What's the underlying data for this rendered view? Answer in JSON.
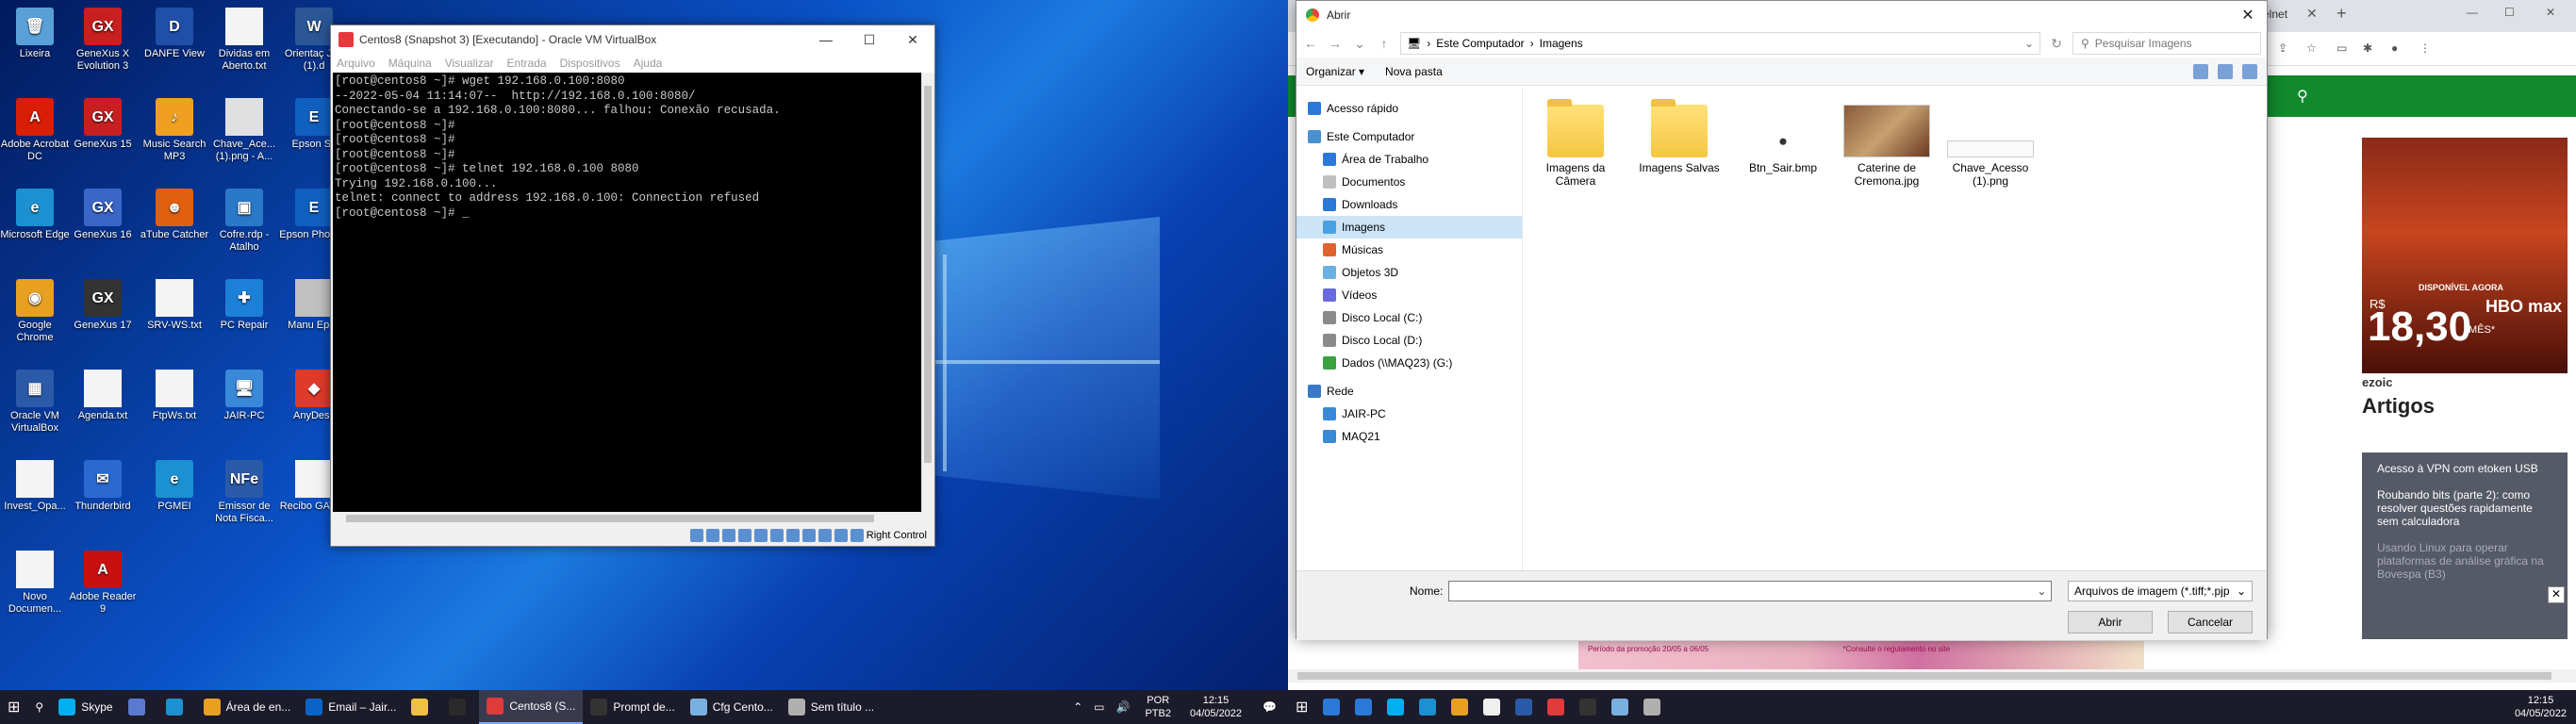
{
  "desktop": {
    "icons": [
      {
        "label": "Lixeira",
        "color": "#5aa0d8",
        "glyph": "🗑"
      },
      {
        "label": "GeneXus X Evolution 3",
        "color": "#c82020",
        "glyph": "GX"
      },
      {
        "label": "DANFE View",
        "color": "#1f4fa8",
        "glyph": "D"
      },
      {
        "label": "Dividas em Aberto.txt",
        "color": "#f4f4f4",
        "glyph": ""
      },
      {
        "label": "Orientaç Jair (1).d",
        "color": "#2b5797",
        "glyph": "W"
      },
      {
        "label": "Adobe Acrobat DC",
        "color": "#d81e05",
        "glyph": "A"
      },
      {
        "label": "GeneXus 15",
        "color": "#c82020",
        "glyph": "GX"
      },
      {
        "label": "Music Search MP3",
        "color": "#f0a020",
        "glyph": "♪"
      },
      {
        "label": "Chave_Ace... (1).png - A...",
        "color": "#e0e0e0",
        "glyph": ""
      },
      {
        "label": "Epson Sc",
        "color": "#1060c0",
        "glyph": "E"
      },
      {
        "label": "Microsoft Edge",
        "color": "#1c90d0",
        "glyph": "e"
      },
      {
        "label": "GeneXus 16",
        "color": "#3a66c8",
        "glyph": "GX"
      },
      {
        "label": "aTube Catcher",
        "color": "#e06010",
        "glyph": "☻"
      },
      {
        "label": "Cofre.rdp - Atalho",
        "color": "#2a78c8",
        "glyph": "▣"
      },
      {
        "label": "Epson Photo P",
        "color": "#1060c0",
        "glyph": "E"
      },
      {
        "label": "Google Chrome",
        "color": "#e8a020",
        "glyph": "◉"
      },
      {
        "label": "GeneXus 17",
        "color": "#333333",
        "glyph": "GX"
      },
      {
        "label": "SRV-WS.txt",
        "color": "#f4f4f4",
        "glyph": ""
      },
      {
        "label": "PC Repair",
        "color": "#1c80d8",
        "glyph": "✚"
      },
      {
        "label": "Manu Epso",
        "color": "#c0c0c0",
        "glyph": ""
      },
      {
        "label": "Oracle VM VirtualBox",
        "color": "#2a5aa8",
        "glyph": "▦"
      },
      {
        "label": "Agenda.txt",
        "color": "#f4f4f4",
        "glyph": ""
      },
      {
        "label": "FtpWs.txt",
        "color": "#f4f4f4",
        "glyph": ""
      },
      {
        "label": "JAIR-PC",
        "color": "#3a88d8",
        "glyph": "🖥"
      },
      {
        "label": "AnyDesk",
        "color": "#e03a2a",
        "glyph": "◆"
      },
      {
        "label": "Invest_Opa...",
        "color": "#f4f4f4",
        "glyph": ""
      },
      {
        "label": "Thunderbird",
        "color": "#2a6ad0",
        "glyph": "✉"
      },
      {
        "label": "PGMEI",
        "color": "#1c90d0",
        "glyph": "e"
      },
      {
        "label": "Emissor de Nota Fisca...",
        "color": "#2a5aa8",
        "glyph": "NFe"
      },
      {
        "label": "Recibo GAT.txt",
        "color": "#f4f4f4",
        "glyph": ""
      },
      {
        "label": "Novo Documen...",
        "color": "#f4f4f4",
        "glyph": ""
      },
      {
        "label": "Adobe Reader 9",
        "color": "#c81010",
        "glyph": "A"
      }
    ]
  },
  "vbox": {
    "title": "Centos8 (Snapshot 3) [Executando] - Oracle VM VirtualBox",
    "menu": [
      "Arquivo",
      "Máquina",
      "Visualizar",
      "Entrada",
      "Dispositivos",
      "Ajuda"
    ],
    "terminal": "[root@centos8 ~]# wget 192.168.0.100:8080\n--2022-05-04 11:14:07--  http://192.168.0.100:8080/\nConectando-se a 192.168.0.100:8080... falhou: Conexão recusada.\n[root@centos8 ~]#\n[root@centos8 ~]#\n[root@centos8 ~]#\n[root@centos8 ~]# telnet 192.168.0.100 8080\nTrying 192.168.0.100...\ntelnet: connect to address 192.168.0.100: Connection refused\n[root@centos8 ~]# _",
    "status_label": "Right Control"
  },
  "taskbar1": {
    "items": [
      {
        "label": "Skype",
        "color": "#00aff0"
      },
      {
        "label": "",
        "color": "#5a7ad0"
      },
      {
        "label": "",
        "color": "#1c90d0"
      },
      {
        "label": "Área de en...",
        "color": "#e8a020"
      },
      {
        "label": "Email – Jair...",
        "color": "#0a64c8"
      },
      {
        "label": "",
        "color": "#f0c040"
      },
      {
        "label": "",
        "color": "#2a2a2a"
      },
      {
        "label": "Centos8 (S...",
        "color": "#e03a3a"
      },
      {
        "label": "Prompt de...",
        "color": "#333333"
      },
      {
        "label": "Cfg Cento...",
        "color": "#7ab0e0"
      },
      {
        "label": "Sem título ...",
        "color": "#b0b0b0"
      }
    ],
    "lang": "POR",
    "layout": "PTB2",
    "time": "12:15",
    "date": "04/05/2022"
  },
  "dialog": {
    "title": "Abrir",
    "path": [
      "Este Computador",
      "Imagens"
    ],
    "search_placeholder": "Pesquisar Imagens",
    "commands": [
      "Organizar ▾",
      "Nova pasta"
    ],
    "nav": [
      {
        "label": "Acesso rápido",
        "color": "#2a78d8",
        "indent": 0,
        "sel": false
      },
      {
        "label": "Este Computador",
        "color": "#4a90d0",
        "indent": 0,
        "sel": false
      },
      {
        "label": "Área de Trabalho",
        "color": "#2a78d8",
        "indent": 1,
        "sel": false
      },
      {
        "label": "Documentos",
        "color": "#c0c0c0",
        "indent": 1,
        "sel": false
      },
      {
        "label": "Downloads",
        "color": "#2a78d8",
        "indent": 1,
        "sel": false
      },
      {
        "label": "Imagens",
        "color": "#4aa0e0",
        "indent": 1,
        "sel": true
      },
      {
        "label": "Músicas",
        "color": "#e06030",
        "indent": 1,
        "sel": false
      },
      {
        "label": "Objetos 3D",
        "color": "#6ab0e0",
        "indent": 1,
        "sel": false
      },
      {
        "label": "Vídeos",
        "color": "#6a6ae0",
        "indent": 1,
        "sel": false
      },
      {
        "label": "Disco Local (C:)",
        "color": "#8a8a8a",
        "indent": 1,
        "sel": false
      },
      {
        "label": "Disco Local (D:)",
        "color": "#8a8a8a",
        "indent": 1,
        "sel": false
      },
      {
        "label": "Dados (\\\\MAQ23) (G:)",
        "color": "#3aa040",
        "indent": 1,
        "sel": false
      },
      {
        "label": "Rede",
        "color": "#3a78c8",
        "indent": 0,
        "sel": false
      },
      {
        "label": "JAIR-PC",
        "color": "#3a88d8",
        "indent": 1,
        "sel": false
      },
      {
        "label": "MAQ21",
        "color": "#3a88d8",
        "indent": 1,
        "sel": false
      }
    ],
    "files": [
      {
        "label": "Imagens da Câmera",
        "kind": "folder"
      },
      {
        "label": "Imagens Salvas",
        "kind": "folder"
      },
      {
        "label": "Btn_Sair.bmp",
        "kind": "bmp"
      },
      {
        "label": "Caterine de Cremona.jpg",
        "kind": "photo"
      },
      {
        "label": "Chave_Acesso (1).png",
        "kind": "png"
      }
    ],
    "name_label": "Nome:",
    "name_value": "",
    "filter": "Arquivos de imagem (*.tiff;*.pjp",
    "open": "Abrir",
    "cancel": "Cancelar"
  },
  "browser": {
    "tab_fragment": "elnet",
    "ad": {
      "available": "DISPONÍVEL AGORA",
      "currency": "R$",
      "price": "18,30",
      "per": "/MÊS*",
      "brand": "HBO max"
    },
    "ezoic": "ezoic",
    "artigos": "Artigos",
    "articles": [
      "Acesso à VPN com etoken USB",
      "Roubando bits (parte 2): como resolver questões rapidamente sem calculadora",
      "Usando Linux para operar plataformas de análise gráfica na Bovespa (B3)"
    ],
    "banner_text": "Período da promoção 20/05 a 06/05",
    "banner_note": "*Consulte o regulamento no site"
  },
  "taskbar2": {
    "icons": [
      "#2a78d8",
      "#2a78d8",
      "#00aff0",
      "#1c90d0",
      "#e8a020",
      "#f0f0f0",
      "#2a5aa8",
      "#e03a3a",
      "#333333",
      "#7ab0e0",
      "#b0b0b0"
    ],
    "time": "12:15",
    "date": "04/05/2022"
  }
}
